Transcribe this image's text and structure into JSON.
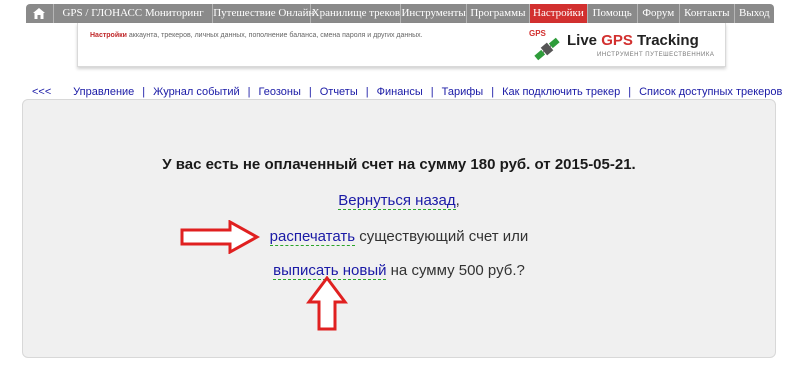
{
  "topnav": {
    "items": [
      {
        "label": "GPS / ГЛОНАСС Мониторинг"
      },
      {
        "label": "Путешествие Онлайн"
      },
      {
        "label": "Хранилище треков"
      },
      {
        "label": "Инструменты"
      },
      {
        "label": "Программы"
      },
      {
        "label": "Настройки",
        "active": true
      },
      {
        "label": "Помощь"
      },
      {
        "label": "Форум"
      },
      {
        "label": "Контакты"
      },
      {
        "label": "Выход"
      }
    ],
    "active_color": "#d2302f",
    "bar_color": "#8a8a8a"
  },
  "banner": {
    "section": "Настройки",
    "description": "аккаунта, трекеров, личных данных, пополнение баланса, смена пароля и других данных.",
    "logo_badge": "GPS",
    "logo_title_1": "Live ",
    "logo_title_gps": "GPS",
    "logo_title_2": " Tracking",
    "logo_subtitle": "ИНСТРУМЕНТ ПУТЕШЕСТВЕННИКА"
  },
  "subnav": {
    "back": "<<<",
    "items": [
      "Управление",
      "Журнал событий",
      "Геозоны",
      "Отчеты",
      "Финансы",
      "Тарифы",
      "Как подключить трекер",
      "Список доступных трекеров"
    ]
  },
  "main": {
    "message": "У вас есть не оплаченный счет на сумму 180 руб. от 2015-05-21.",
    "back_link": "Вернуться назад",
    "back_suffix": ",",
    "print_link": "распечатать",
    "print_suffix": " существующий счет или",
    "new_link": "выписать новый",
    "new_suffix": " на сумму 500 руб.?"
  }
}
